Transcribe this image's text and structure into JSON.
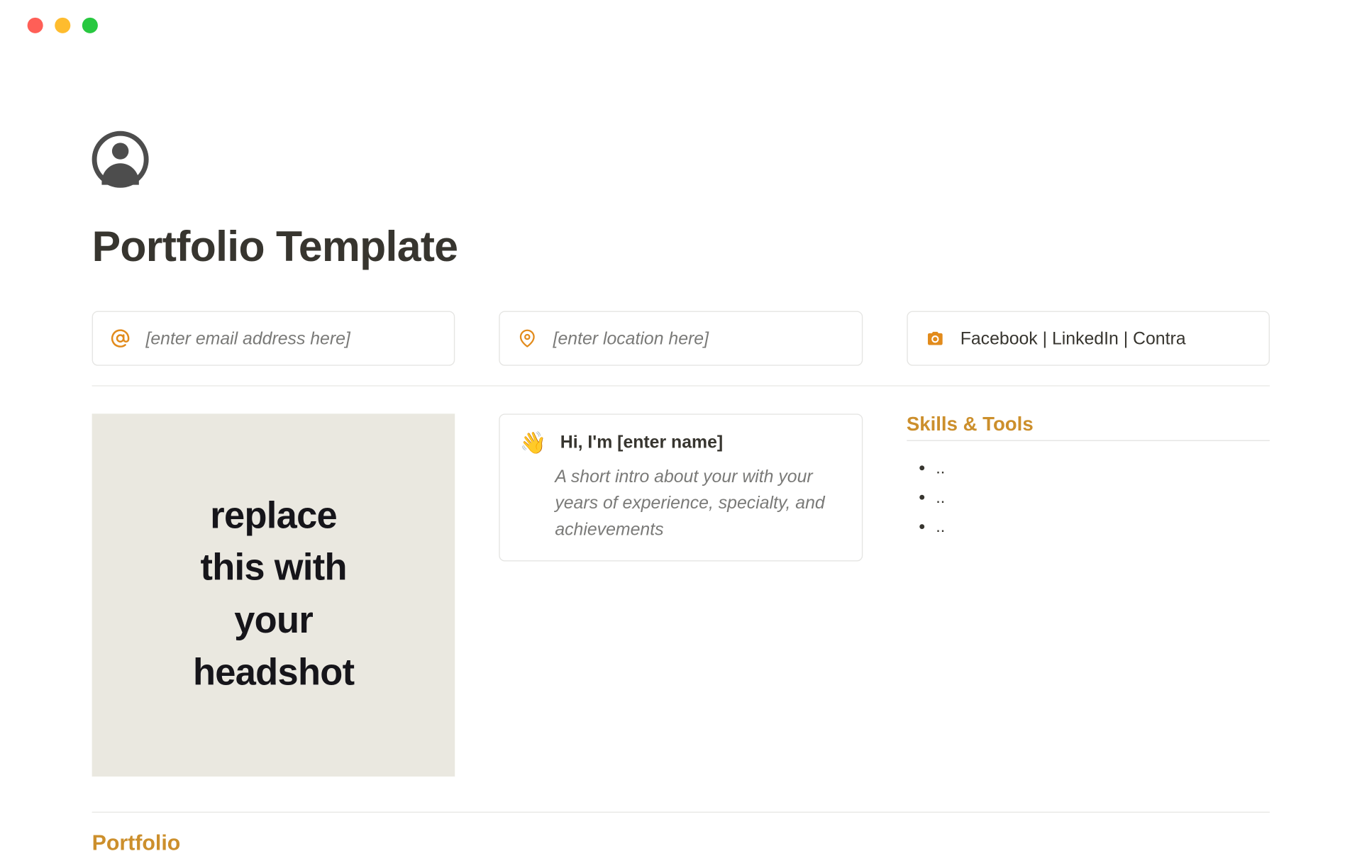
{
  "page_title": "Portfolio Template",
  "contact": {
    "email_placeholder": "[enter email address here]",
    "location_placeholder": "[enter location here]",
    "social_text": "Facebook | LinkedIn | Contra"
  },
  "headshot_placeholder": "replace this with your headshot",
  "intro": {
    "wave_emoji": "👋",
    "heading": "Hi, I'm [enter name]",
    "body": "A short intro about your with your years of experience, specialty, and achievements"
  },
  "skills": {
    "heading": "Skills & Tools",
    "items": [
      "..",
      "..",
      ".."
    ]
  },
  "section_portfolio": "Portfolio",
  "colors": {
    "accent_orange": "#e28b1c",
    "heading_gold": "#cc8f2c"
  }
}
